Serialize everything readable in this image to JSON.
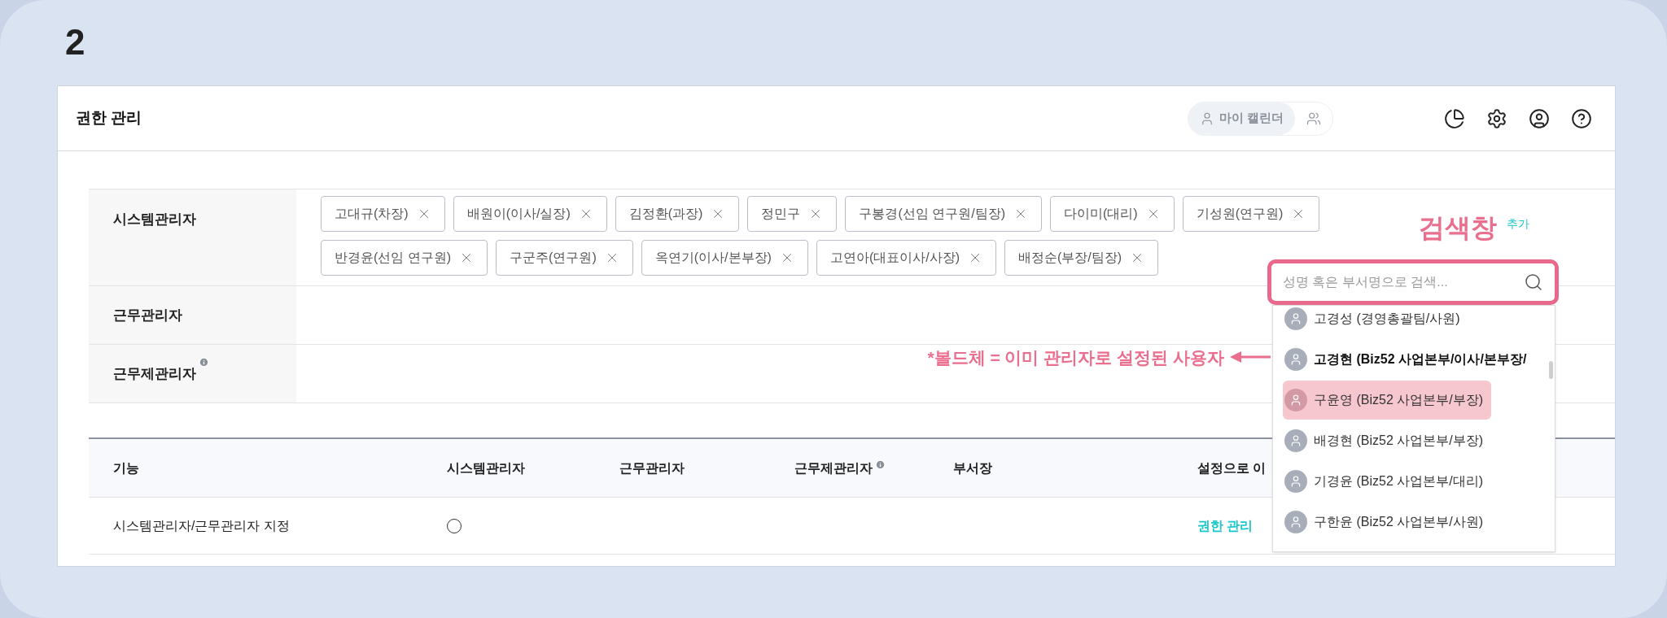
{
  "page_number": "2",
  "header": {
    "title": "권한 관리",
    "calendar_button": "마이 캘린더"
  },
  "admin_groups": [
    {
      "label": "시스템관리자",
      "info": false,
      "tags": [
        "고대규(차장)",
        "배원이(이사/실장)",
        "김정환(과장)",
        "정민구",
        "구봉경(선임 연구원/팀장)",
        "다이미(대리)",
        "기성원(연구원)",
        "반경윤(선임 연구원)",
        "구군주(연구원)",
        "옥연기(이사/본부장)",
        "고연아(대표이사/사장)",
        "배정순(부장/팀장)"
      ]
    },
    {
      "label": "근무관리자",
      "info": false
    },
    {
      "label": "근무제관리자",
      "info": true
    }
  ],
  "search": {
    "title": "검색창",
    "add_link": "추가",
    "placeholder": "성명 혹은 부서명으로 검색...",
    "results": [
      {
        "name": "고경성 (경영총괄팀/사원)",
        "bold": false,
        "selected": false
      },
      {
        "name": "고경현 (Biz52 사업본부/이사/본부장/",
        "bold": true,
        "selected": false
      },
      {
        "name": "구윤영 (Biz52 사업본부/부장)",
        "bold": false,
        "selected": true
      },
      {
        "name": "배경현 (Biz52 사업본부/부장)",
        "bold": false,
        "selected": false
      },
      {
        "name": "기경윤 (Biz52 사업본부/대리)",
        "bold": false,
        "selected": false
      },
      {
        "name": "구한윤 (Biz52 사업본부/사원)",
        "bold": false,
        "selected": false
      }
    ]
  },
  "annotation": "*볼드체 = 이미 관리자로 설정된 사용자",
  "permissions_table": {
    "columns": [
      {
        "label": "기능",
        "info": false
      },
      {
        "label": "시스템관리자",
        "info": false
      },
      {
        "label": "근무관리자",
        "info": false
      },
      {
        "label": "근무제관리자",
        "info": true
      },
      {
        "label": "부서장",
        "info": false
      },
      {
        "label": "설정으로 이",
        "info": false
      }
    ],
    "rows": [
      {
        "cells": [
          {
            "kind": "text",
            "text": "시스템관리자/근무관리자 지정"
          },
          {
            "kind": "radio",
            "checked": false
          },
          {
            "kind": "empty"
          },
          {
            "kind": "empty"
          },
          {
            "kind": "empty"
          },
          {
            "kind": "link",
            "text": "권한 관리"
          }
        ]
      }
    ]
  }
}
